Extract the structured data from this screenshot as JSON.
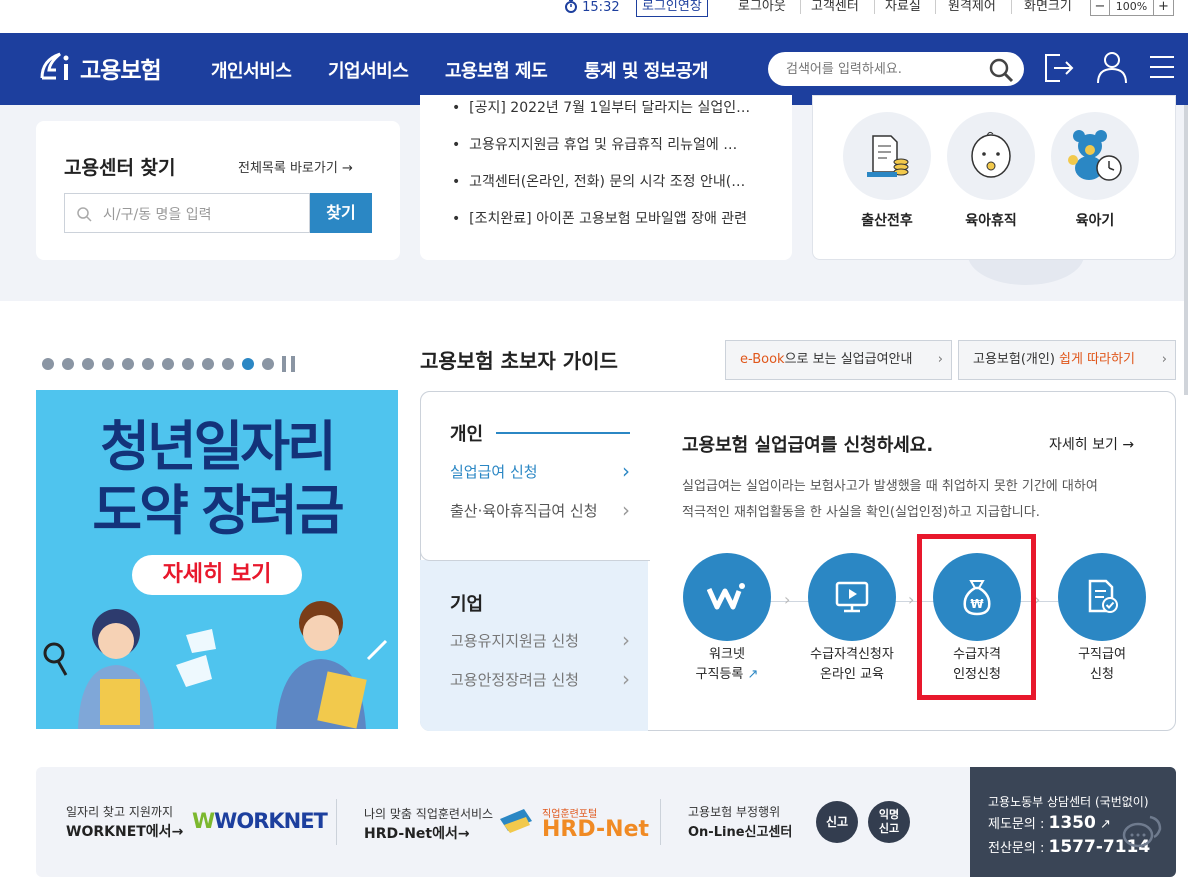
{
  "topbar": {
    "time": "15:32",
    "extend_login": "로그인연장",
    "logout": "로그아웃",
    "customer_center": "고객센터",
    "resources": "자료실",
    "remote": "원격제어",
    "zoom_label": "화면크기",
    "zoom_minus": "−",
    "zoom_value": "100%",
    "zoom_plus": "+"
  },
  "header": {
    "logo": "고용보험",
    "menus": [
      "개인서비스",
      "기업서비스",
      "고용보험 제도",
      "통계 및 정보공개"
    ],
    "search_placeholder": "검색어를 입력하세요."
  },
  "center_finder": {
    "title": "고용센터 찾기",
    "all_link": "전체목록 바로가기",
    "placeholder": "시/구/동 명을 입력",
    "button": "찾기"
  },
  "notices": [
    "[공지] 2022년 7월 1일부터 달라지는 실업인…",
    "고용유지지원금 휴업 및 유급휴직 리뉴얼에 …",
    "고객센터(온라인, 전화) 문의 시각 조정 안내(…",
    "[조치완료] 아이폰 고용보험 모바일앱 장애 관련"
  ],
  "quick": [
    "출산전후",
    "육아휴직",
    "육아기"
  ],
  "banner": {
    "line1": "청년일자리",
    "line2": "도약 장려금",
    "button": "자세히 보기"
  },
  "guide": {
    "title": "고용보험 초보자 가이드",
    "ebook_accent": "e-Book",
    "ebook_rest": "으로 보는 실업급여안내",
    "easy_prefix": "고용보험(개인) ",
    "easy_accent": "쉽게 따라하기",
    "personal": "개인",
    "personal_items": [
      "실업급여 신청",
      "출산·육아휴직급여 신청"
    ],
    "company": "기업",
    "company_items": [
      "고용유지지원금 신청",
      "고용안정장려금 신청"
    ],
    "headline": "고용보험 실업급여를 신청하세요.",
    "more": "자세히 보기",
    "desc1": "실업급여는 실업이라는 보험사고가 발생했을 때 취업하지 못한 기간에 대하여",
    "desc2": "적극적인 재취업활동을 한 사실을 확인(실업인정)하고 지급합니다.",
    "steps": [
      {
        "l1": "워크넷",
        "l2": "구직등록"
      },
      {
        "l1": "수급자격신청자",
        "l2": "온라인 교육"
      },
      {
        "l1": "수급자격",
        "l2": "인정신청"
      },
      {
        "l1": "구직급여",
        "l2": "신청"
      }
    ]
  },
  "footer": {
    "worknet_small": "일자리 찾고 지원까지",
    "worknet_big": "WORKNET에서→",
    "worknet_logo": "WORKNET",
    "hrd_small": "나의 맞춤 직업훈련서비스",
    "hrd_big": "HRD-Net에서→",
    "hrd_portal": "직업훈련포털",
    "hrd_logo": "HRD-Net",
    "report_small": "고용보험 부정행위",
    "report_big": "On-Line신고센터",
    "report_btn": "신고",
    "anon_btn1": "익명",
    "anon_btn2": "신고",
    "call_title": "고용노동부 상담센터 (국번없이)",
    "call1_label": "제도문의 :",
    "call1_num": "1350",
    "call2_label": "전산문의 :",
    "call2_num": "1577-7114"
  },
  "colors": {
    "navy": "#1d3f9e",
    "blue": "#2b87c4",
    "highlight": "#e8182c",
    "accent": "#e0571b"
  }
}
